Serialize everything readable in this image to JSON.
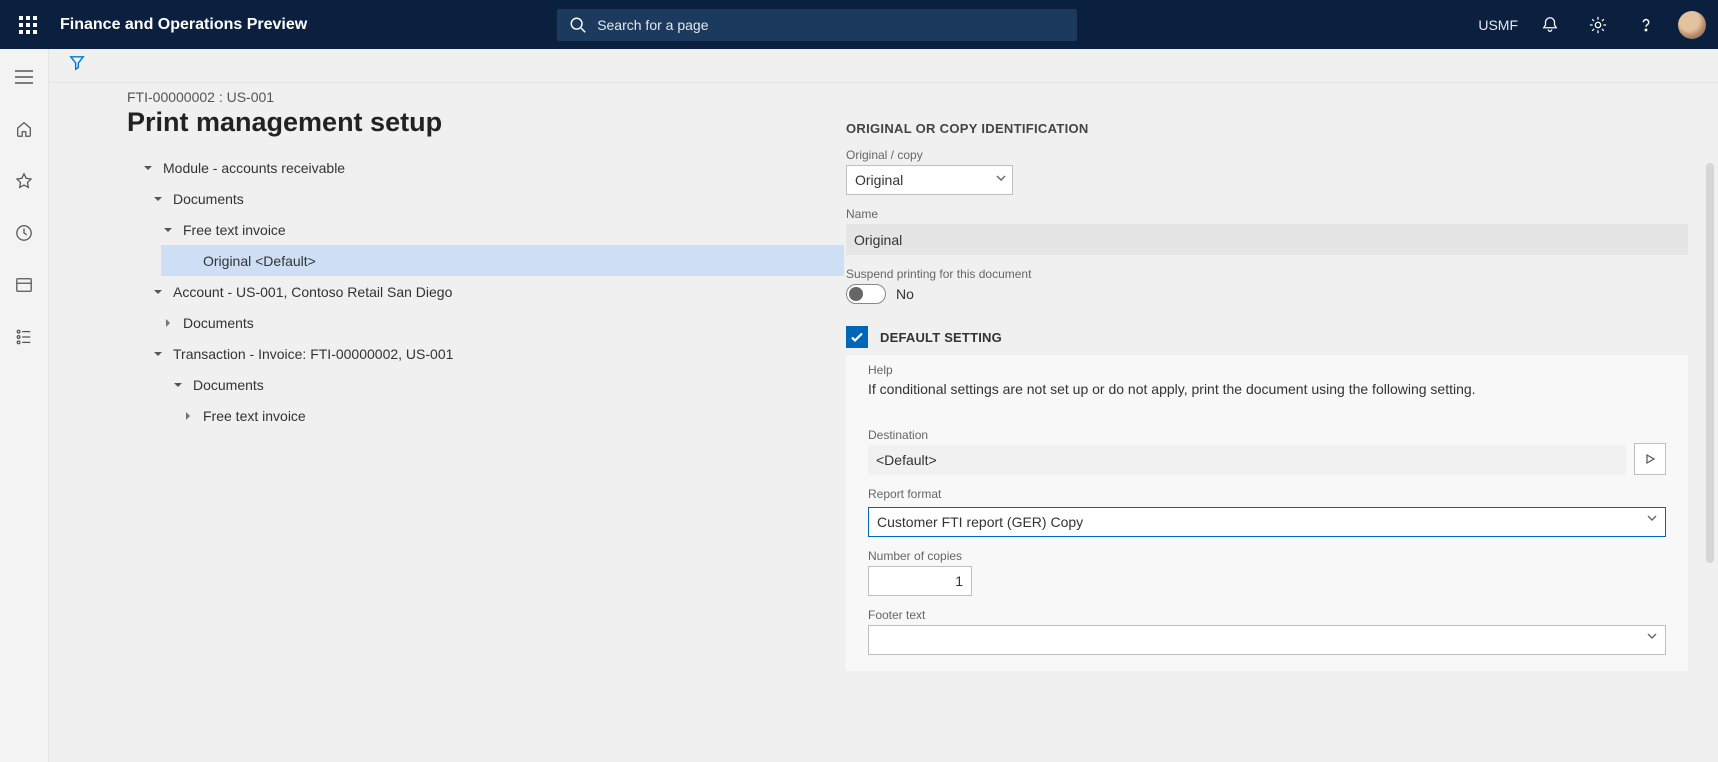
{
  "header": {
    "app_title": "Finance and Operations Preview",
    "search_placeholder": "Search for a page",
    "company": "USMF"
  },
  "page": {
    "breadcrumb": "FTI-00000002 : US-001",
    "title": "Print management setup"
  },
  "tree": {
    "root": "Module - accounts receivable",
    "docs1": "Documents",
    "fti": "Free text invoice",
    "selected": "Original <Default>",
    "account": "Account - US-001, Contoso Retail San Diego",
    "docs2": "Documents",
    "txn": "Transaction - Invoice: FTI-00000002, US-001",
    "docs3": "Documents",
    "fti2": "Free text invoice"
  },
  "form": {
    "section_origcopy": "ORIGINAL OR COPY IDENTIFICATION",
    "lbl_origcopy": "Original / copy",
    "val_origcopy": "Original",
    "lbl_name": "Name",
    "val_name": "Original",
    "lbl_suspend": "Suspend printing for this document",
    "suspend_text": "No",
    "default_label": "DEFAULT SETTING",
    "lbl_help": "Help",
    "help_text": "If conditional settings are not set up or do not apply, print the document using the following setting.",
    "lbl_destination": "Destination",
    "val_destination": "<Default>",
    "lbl_reportformat": "Report format",
    "val_reportformat": "Customer FTI report (GER) Copy",
    "lbl_copies": "Number of copies",
    "val_copies": "1",
    "lbl_footer": "Footer text"
  }
}
